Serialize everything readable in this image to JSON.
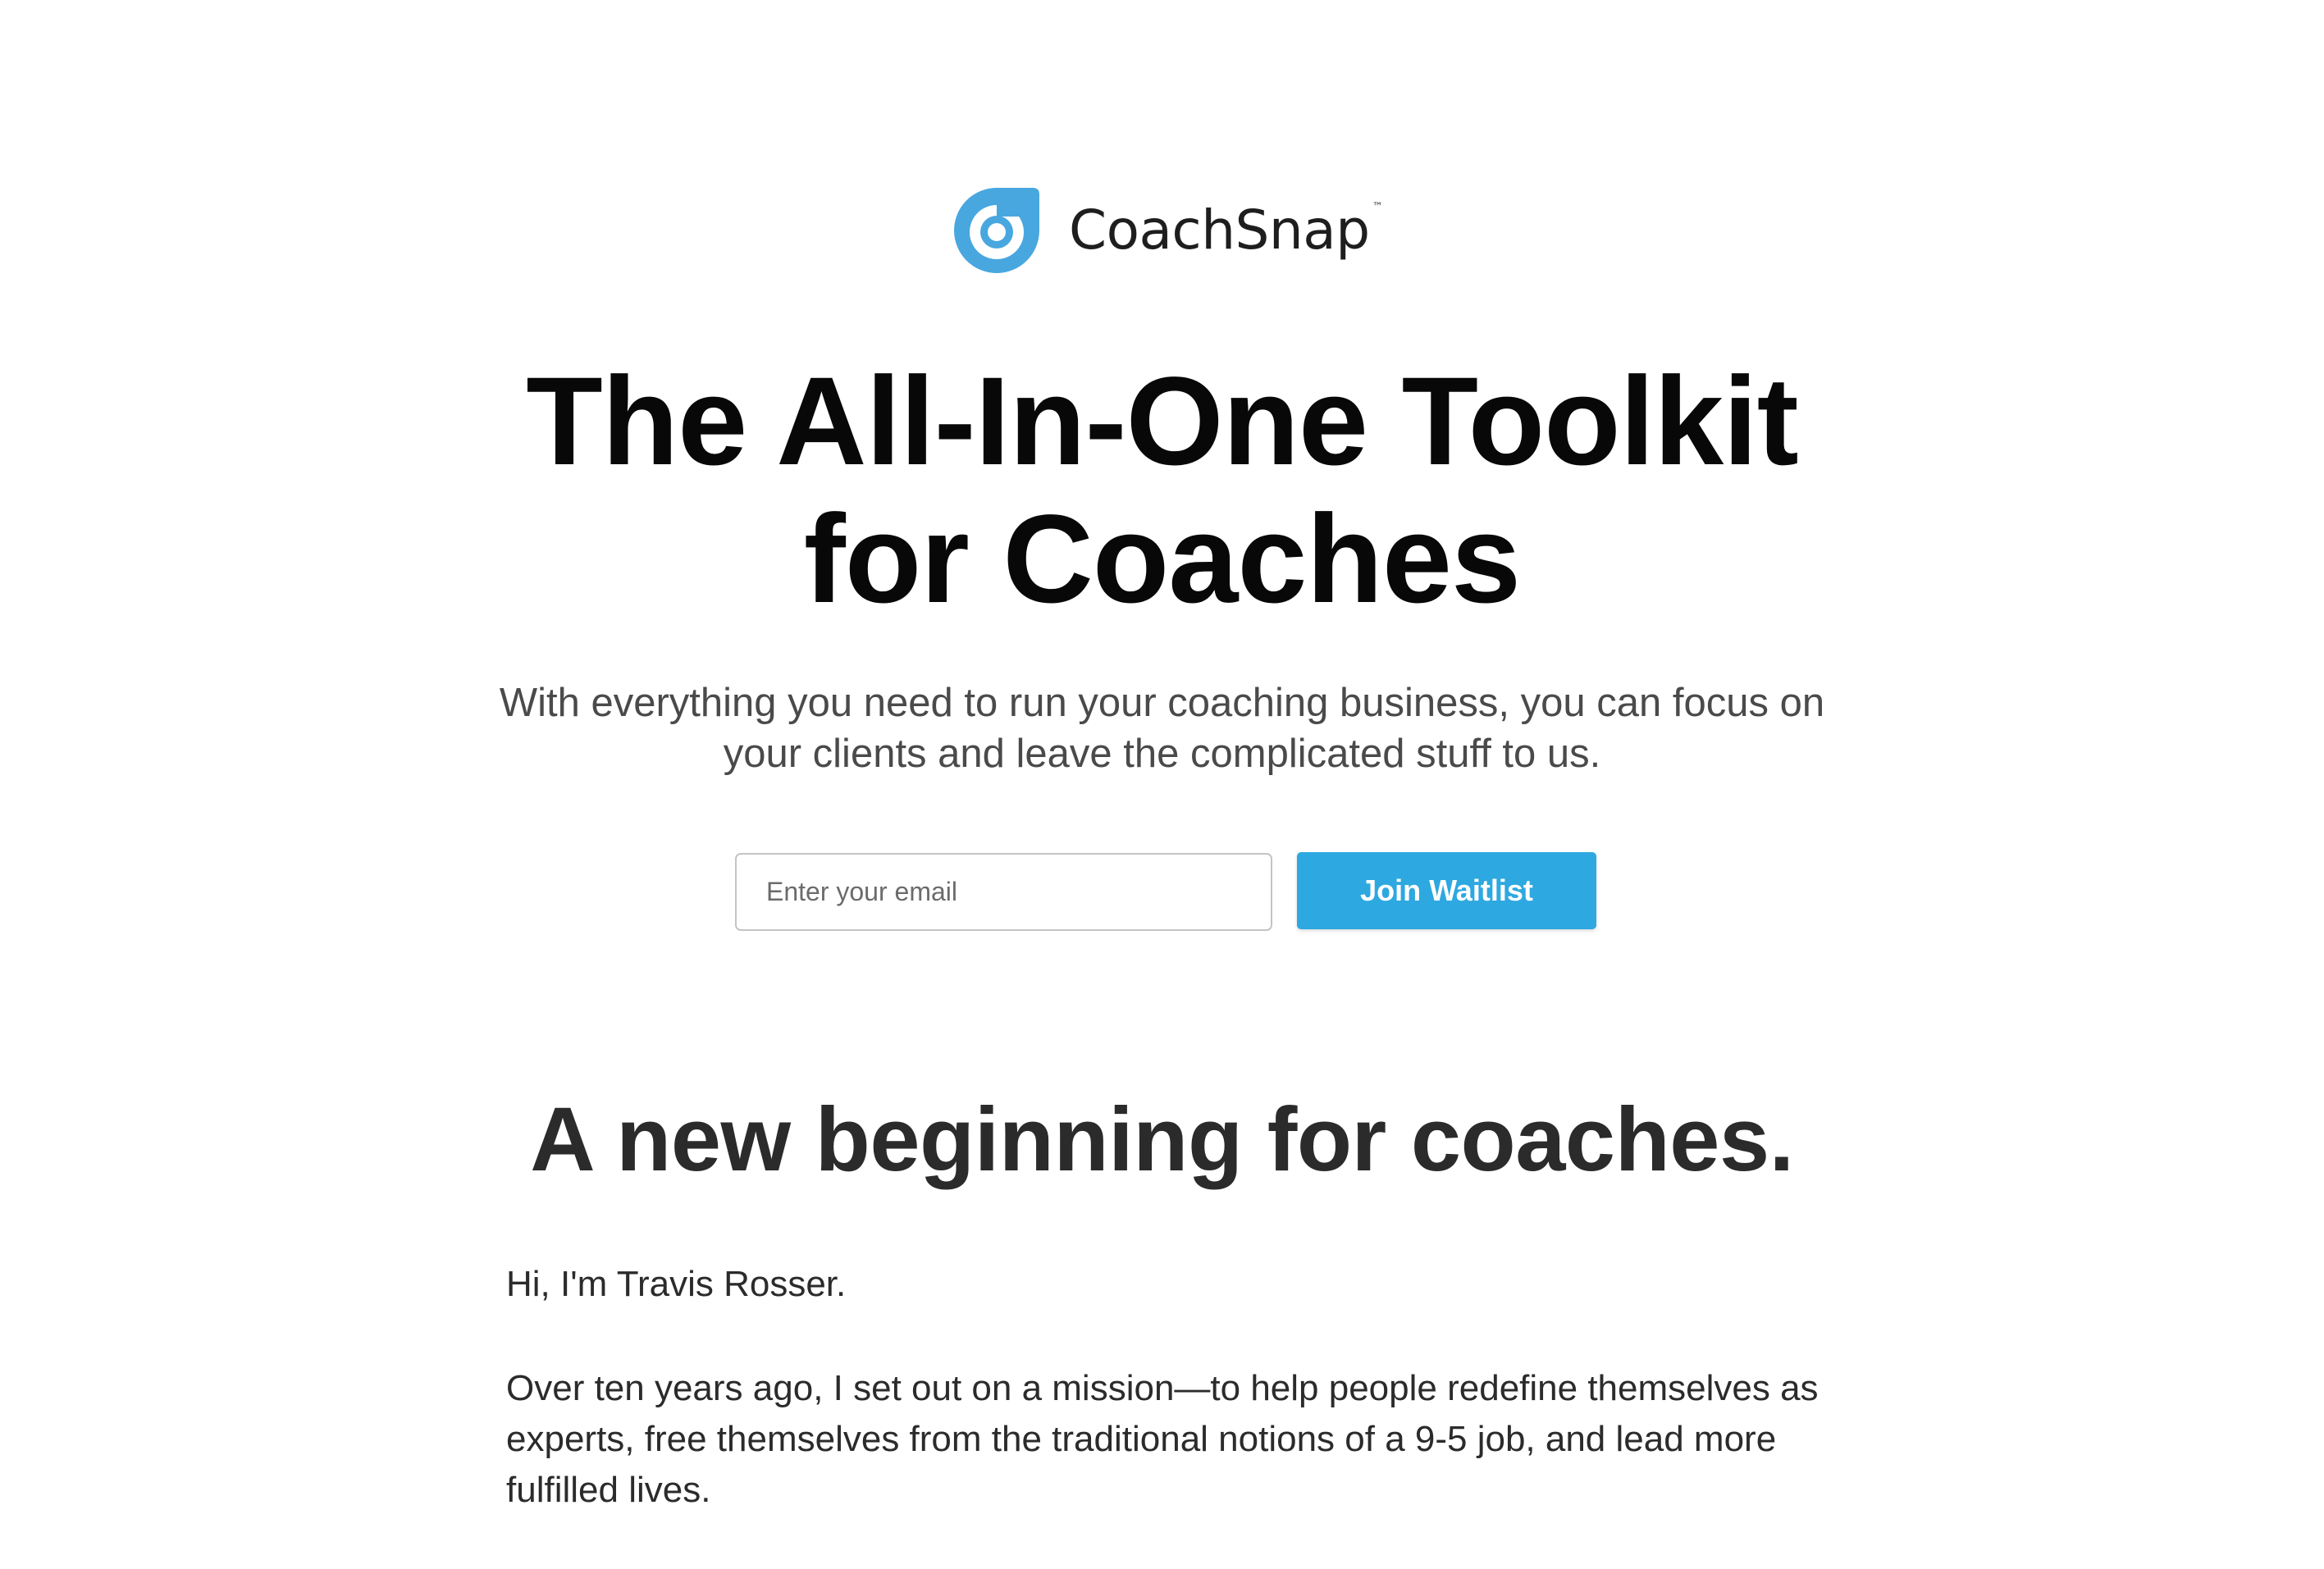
{
  "brand": {
    "name": "CoachSnap",
    "trademark": "™",
    "accent_color": "#49a7df"
  },
  "hero": {
    "title_line1": "The All-In-One Toolkit",
    "title_line2": "for Coaches",
    "subtitle": "With everything you need to run your coaching business, you can focus on your clients and leave the complicated stuff to us."
  },
  "waitlist": {
    "email_placeholder": "Enter your email",
    "email_value": "",
    "button_label": "Join Waitlist",
    "button_color": "#2ea8e0"
  },
  "intro": {
    "heading": "A new beginning for coaches.",
    "paragraphs": [
      "Hi, I'm Travis Rosser.",
      "Over ten years ago, I set out on a mission—to help people redefine themselves as experts, free themselves from the traditional notions of a 9-5 job, and lead more fulfilled lives."
    ]
  }
}
